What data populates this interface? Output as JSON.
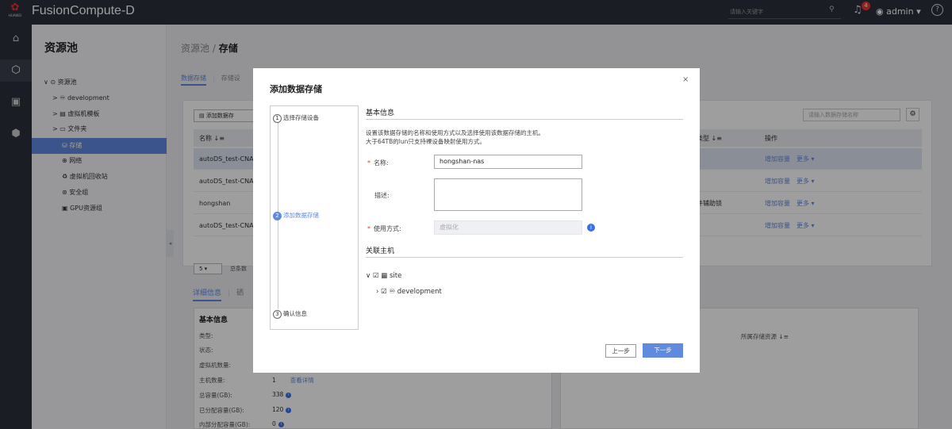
{
  "topbar": {
    "logo_text": "HUAWEI",
    "app_title": "FusionCompute-D",
    "search_placeholder": "请输入关键字",
    "notif_count": "4",
    "user": "admin"
  },
  "sidebar": {
    "title": "资源池",
    "items": [
      {
        "label": "资源池",
        "icon": "⊙",
        "caret": "∨"
      },
      {
        "label": "development",
        "icon": "♾",
        "caret": ">"
      },
      {
        "label": "虚拟机模板",
        "icon": "▤",
        "caret": ">"
      },
      {
        "label": "文件夹",
        "icon": "▭",
        "caret": ">"
      },
      {
        "label": "存储",
        "icon": "⛁"
      },
      {
        "label": "网络",
        "icon": "⊕"
      },
      {
        "label": "虚拟机回收站",
        "icon": "♻"
      },
      {
        "label": "安全组",
        "icon": "⊛"
      },
      {
        "label": "GPU资源组",
        "icon": "▣"
      }
    ]
  },
  "breadcrumb": {
    "root": "资源池",
    "sep": "/",
    "current": "存储"
  },
  "tabs": {
    "data_storage": "数据存储",
    "storage_device": "存储设"
  },
  "table": {
    "add_button": "添加数据存",
    "search_placeholder": "请输入数据存储名称",
    "col_name": "名称 ↓≡",
    "col_type": "锁类型 ↓≡",
    "col_ops": "操作",
    "rows": [
      {
        "name": "autoDS_test-CNA",
        "type": "-",
        "op1": "增加容量",
        "op2": "更多 ▾"
      },
      {
        "name": "autoDS_test-CNA",
        "type": "-",
        "op1": "增加容量",
        "op2": "更多 ▾"
      },
      {
        "name": "hongshan",
        "type": "硬件辅助锁",
        "op1": "增加容量",
        "op2": "更多 ▾"
      },
      {
        "name": "autoDS_test-CNA",
        "type": "-",
        "op1": "增加容量",
        "op2": "更多 ▾"
      }
    ],
    "page_size": "5 ▾",
    "total": "总条数"
  },
  "details": {
    "tab1": "详细信息",
    "tab2": "硒",
    "basic_title": "基本信息",
    "fields": [
      {
        "label": "类型:",
        "value": ""
      },
      {
        "label": "状态:",
        "value": ""
      },
      {
        "label": "虚拟机数量:",
        "value": ""
      },
      {
        "label": "主机数量:",
        "value": "1",
        "link": "查看详情"
      },
      {
        "label": "总容量(GB):",
        "value": "338"
      },
      {
        "label": "已分配容量(GB):",
        "value": "120"
      },
      {
        "label": "内部分配容量(GB):",
        "value": "0"
      }
    ],
    "right_col": "所属存储资源 ↓≡"
  },
  "dialog": {
    "title": "添加数据存储",
    "close": "×",
    "steps": [
      {
        "num": "1",
        "label": "选择存储设备"
      },
      {
        "num": "2",
        "label": "添加数据存储"
      },
      {
        "num": "3",
        "label": "确认信息"
      }
    ],
    "section_basic": "基本信息",
    "desc_line1": "设置该数据存储的名称和使用方式以及选择使用该数据存储的主机。",
    "desc_line2": "大于64TB的lun只支持裸设备映射使用方式。",
    "name_label": "名称:",
    "name_value": "hongshan-nas",
    "desc_label": "描述:",
    "usage_label": "使用方式:",
    "usage_value": "虚拟化",
    "section_hosts": "关联主机",
    "host_root": "site",
    "host_child": "development",
    "prev": "上一步",
    "next": "下一步"
  }
}
